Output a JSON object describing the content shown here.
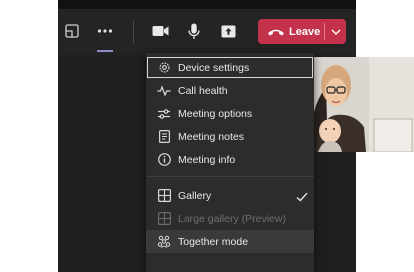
{
  "toolbar": {
    "icons": [
      "share-tray-icon",
      "more-icon",
      "camera-icon",
      "mic-icon",
      "share-icon"
    ],
    "leave_label": "Leave"
  },
  "menu": {
    "items": [
      {
        "label": "Device settings",
        "icon": "gear-icon"
      },
      {
        "label": "Call health",
        "icon": "pulse-icon"
      },
      {
        "label": "Meeting options",
        "icon": "sliders-icon"
      },
      {
        "label": "Meeting notes",
        "icon": "notes-icon"
      },
      {
        "label": "Meeting info",
        "icon": "info-icon"
      },
      {
        "label": "Gallery",
        "icon": "grid-icon",
        "checked": true
      },
      {
        "label": "Large gallery (Preview)",
        "icon": "grid-icon",
        "disabled": true
      },
      {
        "label": "Together mode",
        "icon": "people-icon"
      }
    ]
  },
  "colors": {
    "leave_button": "#c4314b",
    "active_underline": "#8b8cc7",
    "menu_background": "#2d2c2c"
  }
}
